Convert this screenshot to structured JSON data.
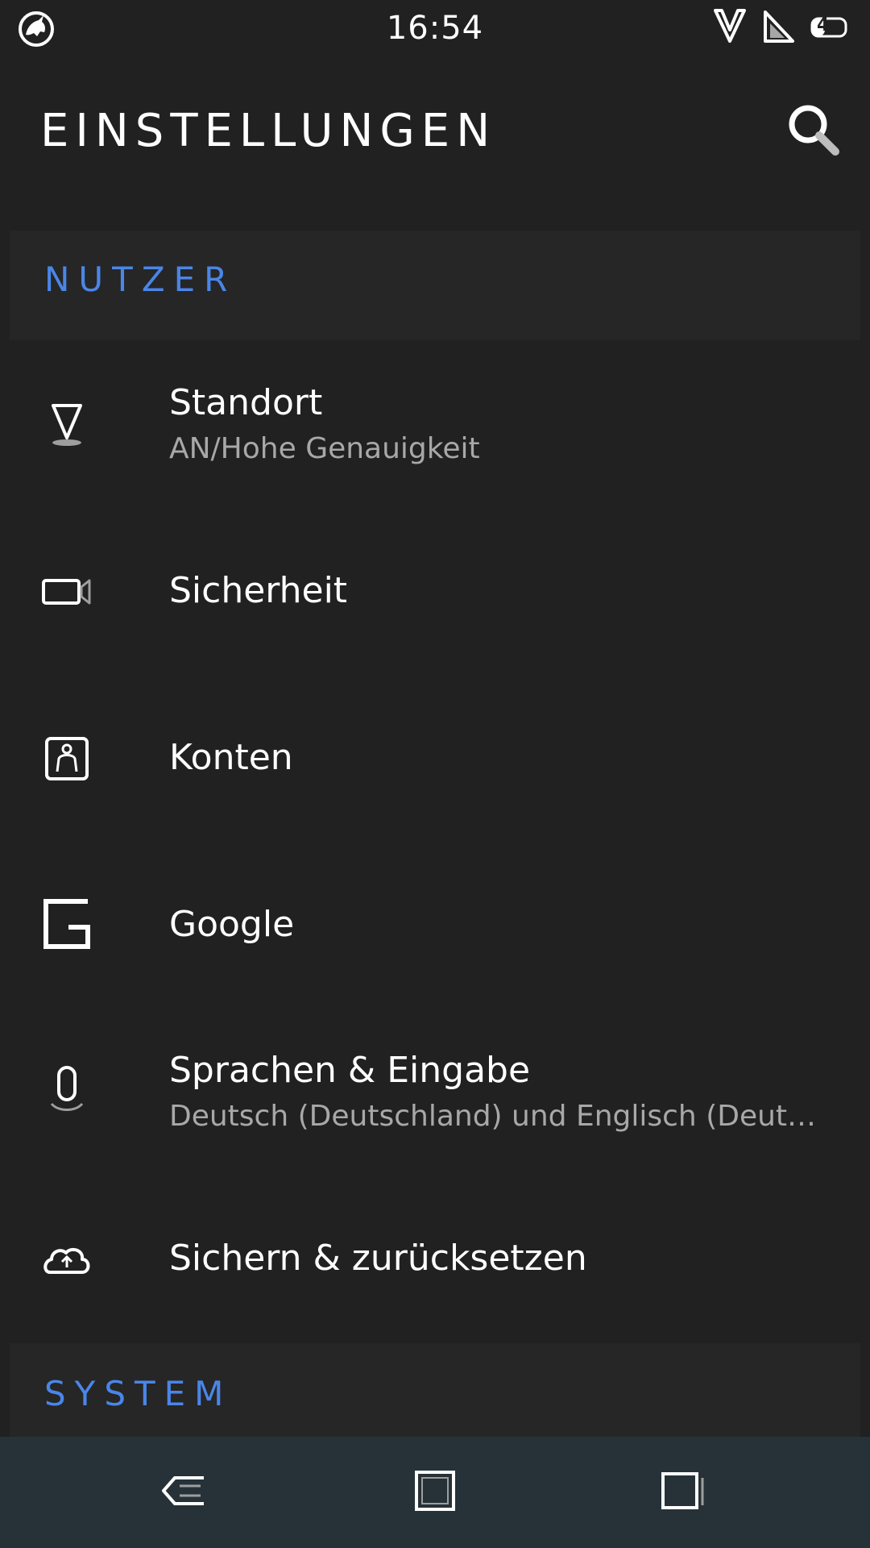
{
  "status_bar": {
    "time": "16:54",
    "battery_level": "4",
    "icons": [
      "unicorn-logo-icon",
      "wifi-icon",
      "signal-icon",
      "battery-icon"
    ]
  },
  "app_bar": {
    "title": "EINSTELLUNGEN",
    "search_icon": "search-icon"
  },
  "sections": {
    "nutzer": {
      "label": "NUTZER"
    },
    "system": {
      "label": "SYSTEM"
    }
  },
  "items": [
    {
      "title": "Standort",
      "subtitle": "AN/Hohe Genauigkeit",
      "icon": "location-pin-icon"
    },
    {
      "title": "Sicherheit",
      "subtitle": "",
      "icon": "security-camera-icon"
    },
    {
      "title": "Konten",
      "subtitle": "",
      "icon": "account-icon"
    },
    {
      "title": "Google",
      "subtitle": "",
      "icon": "google-icon"
    },
    {
      "title": "Sprachen & Eingabe",
      "subtitle": "Deutsch (Deutschland) und Englisch (Deutschland)",
      "icon": "microphone-icon"
    },
    {
      "title": "Sichern & zurücksetzen",
      "subtitle": "",
      "icon": "cloud-upload-icon"
    }
  ],
  "nav_bar": {
    "icons": [
      "back-icon",
      "home-icon",
      "recents-icon"
    ]
  },
  "colors": {
    "background": "#212121",
    "section_background": "#262626",
    "accent": "#4a86e8",
    "nav_background": "#263238",
    "subtitle": "#a8a8a8"
  }
}
